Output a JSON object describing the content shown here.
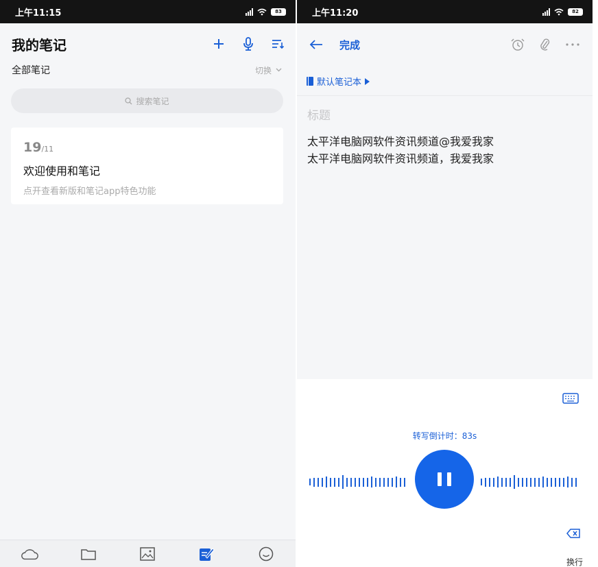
{
  "left": {
    "status_time": "上午11:15",
    "battery": "83",
    "title": "我的笔记",
    "filter_label": "全部笔记",
    "switch_label": "切换",
    "search_placeholder": "搜索笔记",
    "note": {
      "day": "19",
      "month": "/11",
      "title": "欢迎使用和笔记",
      "desc": "点开查看新版和笔记app特色功能"
    },
    "tabs": [
      "cloud-icon",
      "folder-icon",
      "image-icon",
      "note-edit-icon",
      "smiley-icon"
    ]
  },
  "right": {
    "status_time": "上午11:20",
    "battery": "82",
    "done_label": "完成",
    "notebook": "默认笔记本",
    "title_placeholder": "标题",
    "body_lines": [
      "太平洋电脑网软件资讯频道@我爱我家",
      "太平洋电脑网软件资讯频道，我爱我家"
    ],
    "countdown": "转写倒计时：83s",
    "newline_label": "换行"
  },
  "colors": {
    "accent": "#1a5fd6",
    "record_button": "#1565e8",
    "status_bar": "#141414"
  }
}
